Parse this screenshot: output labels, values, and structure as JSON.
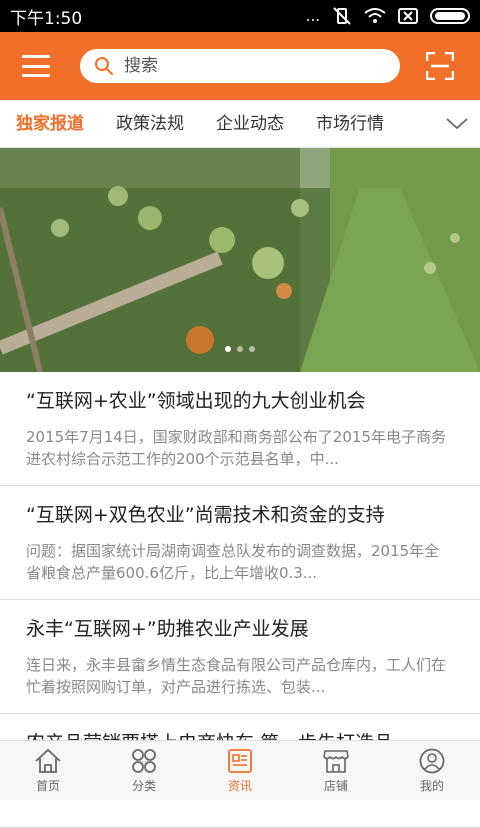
{
  "status": {
    "time": "下午1:50",
    "signal_text": "..."
  },
  "header": {
    "search_placeholder": "搜索"
  },
  "tabs": [
    {
      "label": "独家报道",
      "active": true
    },
    {
      "label": "政策法规",
      "active": false
    },
    {
      "label": "企业动态",
      "active": false
    },
    {
      "label": "市场行情",
      "active": false
    }
  ],
  "banner": {
    "slides": 3,
    "active_slide": 1
  },
  "news": [
    {
      "title": "“互联网+农业”领域出现的九大创业机会",
      "desc": "2015年7月14日，国家财政部和商务部公布了2015年电子商务进农村综合示范工作的200个示范县名单，中..."
    },
    {
      "title": "“互联网+双色农业”尚需技术和资金的支持",
      "desc": "问题：据国家统计局湖南调查总队发布的调查数据，2015年全省粮食总产量600.6亿斤，比上年增收0.3..."
    },
    {
      "title": "永丰“互联网+”助推农业产业发展",
      "desc": "连日来，永丰县畲乡情生态食品有限公司产品仓库内，工人们在忙着按照网购订单，对产品进行拣选、包装..."
    },
    {
      "title": "农产品营销要搭上电商快车 第一步先打造品",
      "desc": ""
    }
  ],
  "bottom_nav": [
    {
      "label": "首页",
      "icon": "home-icon"
    },
    {
      "label": "分类",
      "icon": "category-icon"
    },
    {
      "label": "资讯",
      "icon": "news-icon",
      "active": true
    },
    {
      "label": "店铺",
      "icon": "store-icon"
    },
    {
      "label": "我的",
      "icon": "user-icon"
    }
  ],
  "colors": {
    "accent": "#f26f2a",
    "status_bar": "#000000"
  }
}
